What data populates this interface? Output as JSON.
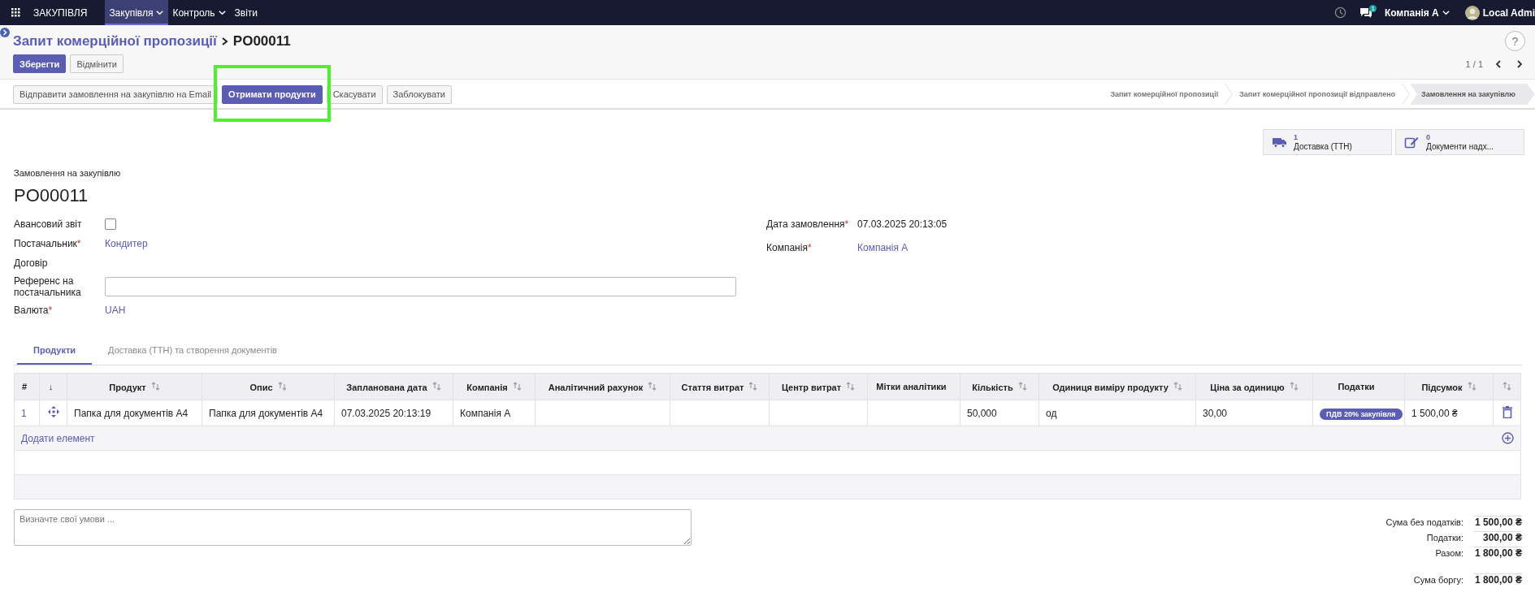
{
  "navbar": {
    "app": "ЗАКУПІВЛЯ",
    "menus": [
      {
        "label": "Закупівля",
        "selected": true,
        "dropdown": true
      },
      {
        "label": "Контроль",
        "selected": false,
        "dropdown": true
      },
      {
        "label": "Звіти",
        "selected": false,
        "dropdown": false
      }
    ],
    "messages_badge": "1",
    "company": "Компанія А",
    "user": "Local Admi"
  },
  "breadcrumb": {
    "parent": "Запит комерційної пропозиції",
    "current": "PO00011"
  },
  "help": "?",
  "edit_buttons": [
    {
      "label": "Зберегти",
      "primary": true
    },
    {
      "label": "Відмінити",
      "primary": false
    }
  ],
  "pager": "1 / 1",
  "actions": [
    {
      "label": "Відправити замовлення на закупівлю на Email",
      "primary": false,
      "highlighted": false
    },
    {
      "label": "Отримати продукти",
      "primary": true,
      "highlighted": true
    },
    {
      "label": "Скасувати",
      "primary": false,
      "highlighted": false
    },
    {
      "label": "Заблокувати",
      "primary": false,
      "highlighted": false
    }
  ],
  "stages": [
    {
      "label": "Запит комерційної пропозиції",
      "selected": false
    },
    {
      "label": "Запит комерційної пропозиції відправлено",
      "selected": false
    },
    {
      "label": "Замовлення на закупівлю",
      "selected": true
    }
  ],
  "smart_buttons": [
    {
      "kind": "truck",
      "count": "1",
      "label": "Доставка (ТТН)"
    },
    {
      "kind": "edit",
      "count": "0",
      "label": "Документи надх..."
    }
  ],
  "form": {
    "subtitle": "Замовлення на закупівлю",
    "name": "PO00011",
    "left_fields": [
      {
        "kind": "checkbox",
        "label": "Авансовий звіт",
        "checked": false
      },
      {
        "kind": "link",
        "label": "Постачальник",
        "required_mark": "*",
        "value": "Кондитер"
      },
      {
        "kind": "empty",
        "label": "Договір"
      },
      {
        "kind": "input",
        "label": "Референс на постачальника"
      },
      {
        "kind": "link",
        "label": "Валюта",
        "required_mark": "*",
        "value": "UAH"
      }
    ],
    "right_fields": [
      {
        "kind": "text",
        "label": "Дата замовлення",
        "required_mark": "*",
        "value": "07.03.2025 20:13:05"
      },
      {
        "kind": "link",
        "label": "Компанія",
        "required_mark": "*",
        "value": "Компанія А"
      }
    ]
  },
  "tabs": [
    {
      "label": "Продукти",
      "selected": true
    },
    {
      "label": "Доставка (ТТН) та створення документів",
      "selected": false
    }
  ],
  "table": {
    "columns": [
      {
        "label": "#",
        "sortable": false
      },
      {
        "label": "↓",
        "sortable": false
      },
      {
        "label": "Продукт",
        "sortable": true
      },
      {
        "label": "Опис",
        "sortable": true
      },
      {
        "label": "Запланована дата",
        "sortable": true
      },
      {
        "label": "Компанія",
        "sortable": true
      },
      {
        "label": "Аналітичний рахунок",
        "sortable": true
      },
      {
        "label": "Стаття витрат",
        "sortable": true
      },
      {
        "label": "Центр витрат",
        "sortable": true
      },
      {
        "label": "Мітки аналітики",
        "sortable": false
      },
      {
        "label": "Кількість",
        "sortable": true
      },
      {
        "label": "Одиниця виміру продукту",
        "sortable": true
      },
      {
        "label": "Ціна за одиницю",
        "sortable": true
      },
      {
        "label": "Податки",
        "sortable": false
      },
      {
        "label": "Підсумок",
        "sortable": true
      },
      {
        "sortable": true
      }
    ],
    "rows": [
      {
        "cells": [
          {
            "kind": "link",
            "text": "1"
          },
          {
            "kind": "handle"
          },
          {
            "kind": "text",
            "text": "Папка для документів A4"
          },
          {
            "kind": "text",
            "text": "Папка для документів A4"
          },
          {
            "kind": "text",
            "text": "07.03.2025 20:13:19"
          },
          {
            "kind": "text",
            "text": "Компанія А"
          },
          {
            "kind": "empty"
          },
          {
            "kind": "empty"
          },
          {
            "kind": "empty"
          },
          {
            "kind": "empty"
          },
          {
            "kind": "text",
            "text": "50,000"
          },
          {
            "kind": "text",
            "text": "од"
          },
          {
            "kind": "text",
            "text": "30,00"
          },
          {
            "kind": "tag",
            "text": "ПДВ 20% закупівля"
          },
          {
            "kind": "text",
            "text": "1 500,00 ₴"
          },
          {
            "kind": "delete"
          }
        ]
      }
    ],
    "add_line": "Додати елемент"
  },
  "notes": {
    "placeholder": "Визначте свої умови ..."
  },
  "totals": [
    {
      "kind": "line",
      "label": "Сума без податків:",
      "value": "1 500,00 ₴"
    },
    {
      "kind": "line",
      "label": "Податки:",
      "value": "300,00 ₴"
    },
    {
      "kind": "line",
      "label": "Разом:",
      "value": "1 800,00 ₴"
    },
    {
      "kind": "due",
      "label": "Сума боргу:",
      "value": "1 800,00 ₴"
    }
  ]
}
